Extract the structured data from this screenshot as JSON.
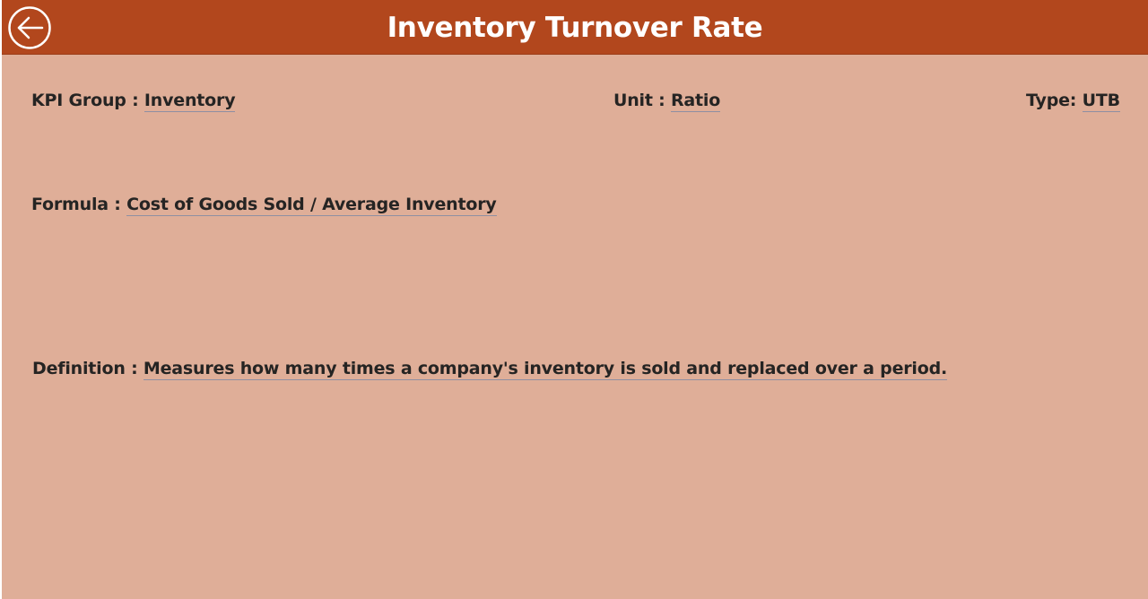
{
  "header": {
    "title": "Inventory Turnover Rate",
    "back_icon": "arrow-left-circle-icon",
    "background_color": "#b2471d"
  },
  "fields": {
    "kpi_group": {
      "label": "KPI Group : ",
      "value": "Inventory"
    },
    "unit": {
      "label": "Unit : ",
      "value": "Ratio"
    },
    "type": {
      "label": "Type: ",
      "value": "UTB"
    },
    "formula": {
      "label": "Formula : ",
      "value": "Cost of Goods Sold / Average Inventory"
    },
    "definition": {
      "label": "Definition : ",
      "value": "Measures how many times a company's inventory is sold and replaced over a period."
    }
  },
  "colors": {
    "page_background": "#dfae98",
    "text": "#252423",
    "underline": "#8f8fa3"
  }
}
